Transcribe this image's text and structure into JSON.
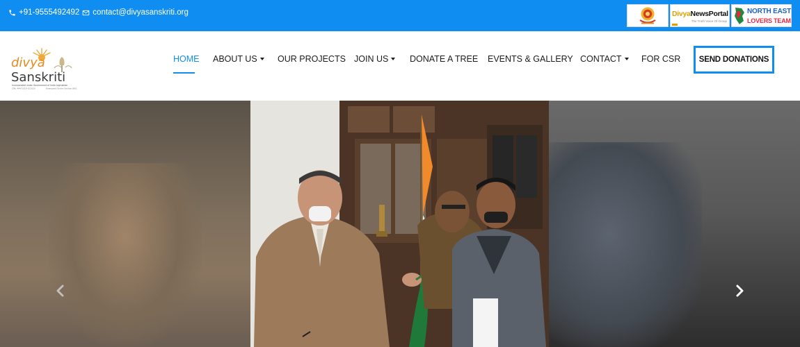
{
  "topbar": {
    "phone": "+91-9555492492",
    "email": "contact@divyasanskriti.org",
    "icons": [
      "phone-icon",
      "mail-icon"
    ],
    "partners": {
      "divya_news": {
        "part1": "Divya",
        "part2": "NewsPortal",
        "tagline": "The Truth Voice Of Group"
      },
      "north_east": {
        "line1": "NORTH EAST",
        "line2": "LOVERS TEAM"
      }
    }
  },
  "logo": {
    "line1": "divya",
    "line2": "Sanskriti",
    "tagline1": "Incorporated under Government of India Legislation",
    "tagline2": "CIN: 44473/19-G/2020",
    "tagline3": "Exempted Under Section 80G"
  },
  "nav": {
    "items": [
      {
        "label": "HOME",
        "active": true
      },
      {
        "label": "ABOUT US",
        "dropdown": true
      },
      {
        "label": "OUR PROJECTS"
      },
      {
        "label": "JOIN US",
        "dropdown": true
      },
      {
        "label": "DONATE A TREE"
      },
      {
        "label": "EVENTS & GALLERY"
      },
      {
        "label": "CONTACT",
        "dropdown": true
      },
      {
        "label": "FOR CSR"
      }
    ],
    "cta": "SEND DONATIONS"
  },
  "hero": {
    "arrows": [
      "chevron-left-icon",
      "chevron-right-icon"
    ]
  },
  "colors": {
    "brand_blue": "#0f8df1",
    "nav_text": "#1c1c1c",
    "logo_orange": "#e68a1d",
    "logo_dark": "#3a3a3a"
  }
}
